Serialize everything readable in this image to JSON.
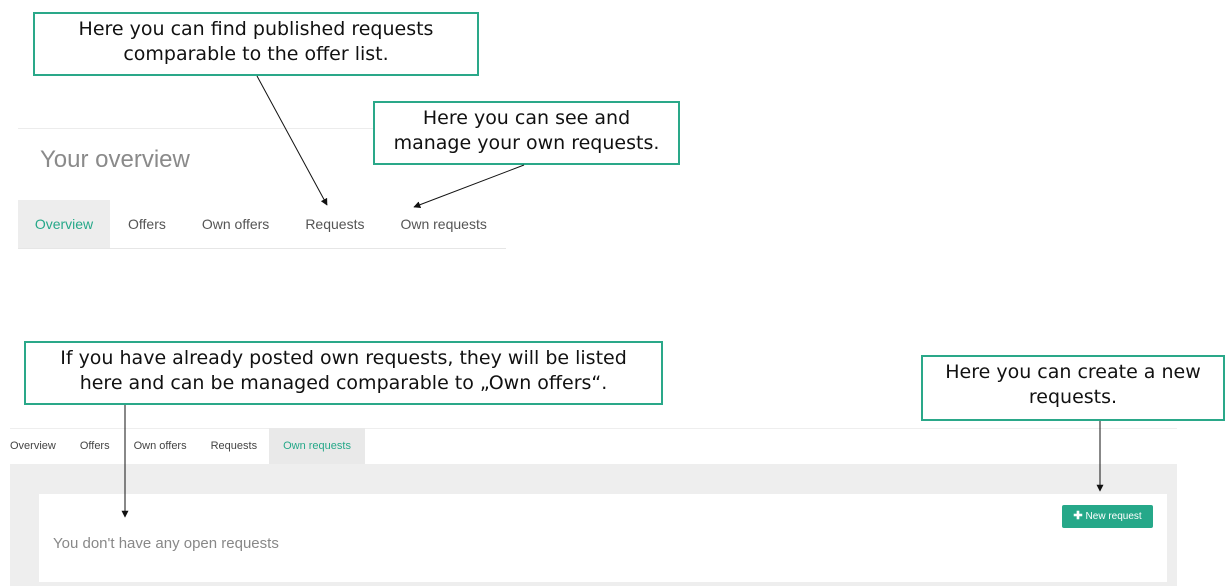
{
  "callouts": {
    "published_requests": "Here you can find published requests\ncomparable to the offer list.",
    "own_requests_manage": "Here you can see and\nmanage your own requests.",
    "listed_requests": "If you have already posted own requests, they will be listed\nhere and can be managed comparable to „Own offers“.",
    "create_request": "Here you can create a new\nrequests."
  },
  "top_panel": {
    "title": "Your overview",
    "tabs": [
      {
        "label": "Overview",
        "active": true
      },
      {
        "label": "Offers",
        "active": false
      },
      {
        "label": "Own offers",
        "active": false
      },
      {
        "label": "Requests",
        "active": false
      },
      {
        "label": "Own requests",
        "active": false
      }
    ]
  },
  "bottom_panel": {
    "tabs": [
      {
        "label": "Overview",
        "active": false
      },
      {
        "label": "Offers",
        "active": false
      },
      {
        "label": "Own offers",
        "active": false
      },
      {
        "label": "Requests",
        "active": false
      },
      {
        "label": "Own requests",
        "active": true
      }
    ],
    "new_request_button": "New request",
    "new_request_icon": "plus-icon",
    "empty_message": "You don't have any open requests"
  },
  "colors": {
    "accent": "#26a889",
    "callout_border": "#2aa889",
    "active_tab_bg": "#ededed",
    "content_bg": "#eeeeee"
  }
}
